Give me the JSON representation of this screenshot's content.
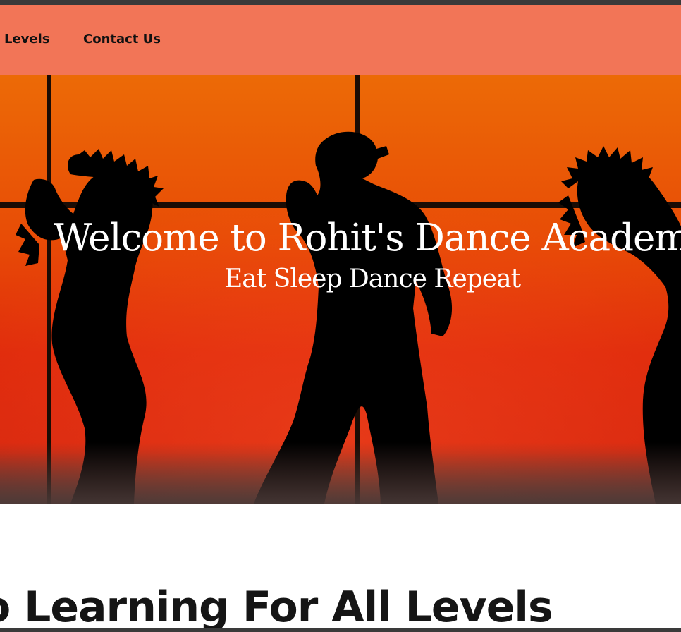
{
  "nav": {
    "items": [
      {
        "label": "Levels"
      },
      {
        "label": "Contact Us"
      }
    ]
  },
  "hero": {
    "title": "Welcome to Rohit's Dance Academy",
    "subtitle": "Eat Sleep Dance Repeat",
    "image_alt": "silhouettes of dancers against an orange window"
  },
  "section": {
    "heading": "o Learning For All Levels"
  },
  "colors": {
    "nav_background": "#f27557",
    "hero_top": "#ec6a06",
    "hero_bottom": "#d9280f",
    "text_light": "#ffffff",
    "text_dark": "#151515"
  }
}
